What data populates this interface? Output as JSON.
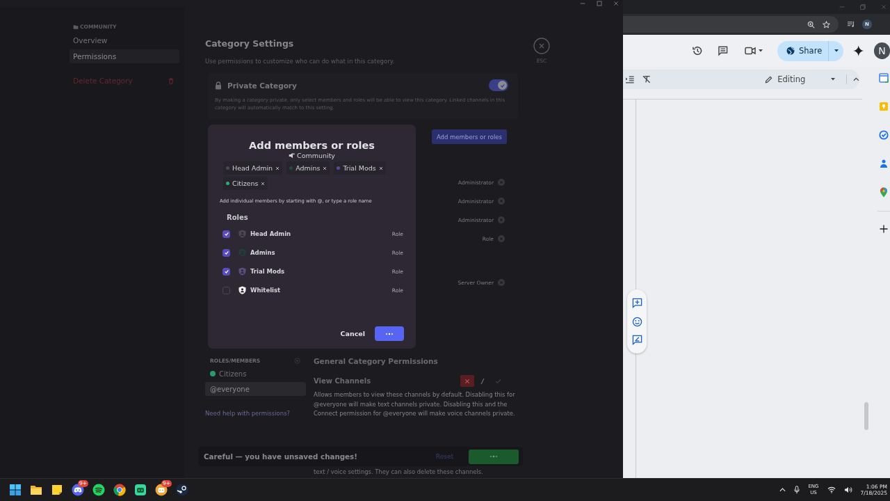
{
  "discord": {
    "sidebar": {
      "section": "COMMUNITY",
      "items": [
        {
          "label": "Overview",
          "selected": false
        },
        {
          "label": "Permissions",
          "selected": true
        }
      ],
      "delete_label": "Delete Category"
    },
    "header": {
      "title": "Category Settings",
      "subtitle": "Use permissions to customize who can do what in this category.",
      "close_label": "ESC"
    },
    "private": {
      "title": "Private Category",
      "on": true,
      "description": "By making a category private, only select members and roles will be able to view this category. Linked channels in this category will automatically match to this setting."
    },
    "add_button": "Add members or roles",
    "members": [
      {
        "tag": "Administrator"
      },
      {
        "tag": "Administrator"
      },
      {
        "tag": "Administrator"
      },
      {
        "tag": "Role"
      },
      {
        "tag": "Server Owner"
      }
    ],
    "roles_members": {
      "heading": "ROLES/MEMBERS",
      "items": [
        {
          "label": "Citizens",
          "color": "#2a9a6a",
          "selected": false
        },
        {
          "label": "@everyone",
          "selected": true
        }
      ],
      "help": "Need help with permissions?"
    },
    "permissions": {
      "heading": "General Category Permissions",
      "items": [
        {
          "name": "View Channels",
          "denied": true,
          "allowed": false,
          "description": "Allows members to view these channels by default. Disabling this for @everyone will make text channels private. Disabling this and the Connect permission for @everyone will make voice channels private."
        }
      ],
      "trailing_text": "text / voice settings. They can also delete these channels."
    },
    "unsaved": {
      "message": "Careful — you have unsaved changes!",
      "reset": "Reset"
    }
  },
  "modal": {
    "title": "Add members or roles",
    "server": "Community",
    "chips": [
      {
        "label": "Head Admin",
        "color": "#4a4854"
      },
      {
        "label": "Admins",
        "color": "#1f4a40"
      },
      {
        "label": "Trial Mods",
        "color": "#5a4a9a"
      },
      {
        "label": "Citizens",
        "color": "#2eaa7a"
      }
    ],
    "hint": "Add individual members by starting with @, or type a role name",
    "section": "Roles",
    "roles": [
      {
        "name": "Head Admin",
        "type": "Role",
        "checked": true,
        "color": "#4a4854"
      },
      {
        "name": "Admins",
        "type": "Role",
        "checked": true,
        "color": "#1f3f38"
      },
      {
        "name": "Trial Mods",
        "type": "Role",
        "checked": true,
        "color": "#5a4e80"
      },
      {
        "name": "Whitelist",
        "type": "Role",
        "checked": false,
        "color": "#f2f2f2"
      }
    ],
    "cancel": "Cancel"
  },
  "browser": {
    "profile_initial": "N",
    "share_label": "Share",
    "avatar_initial": "N",
    "mode_label": "Editing"
  },
  "taskbar": {
    "apps": [
      {
        "kind": "windows"
      },
      {
        "kind": "folder"
      },
      {
        "kind": "notes"
      },
      {
        "kind": "discord",
        "badge": "9+"
      },
      {
        "kind": "spotify"
      },
      {
        "kind": "chrome"
      },
      {
        "kind": "gamepad"
      },
      {
        "kind": "bot",
        "badge": "9+"
      },
      {
        "kind": "steam"
      }
    ],
    "language": "ENG",
    "region": "US",
    "time": "1:06 PM",
    "date": "7/18/2025"
  }
}
